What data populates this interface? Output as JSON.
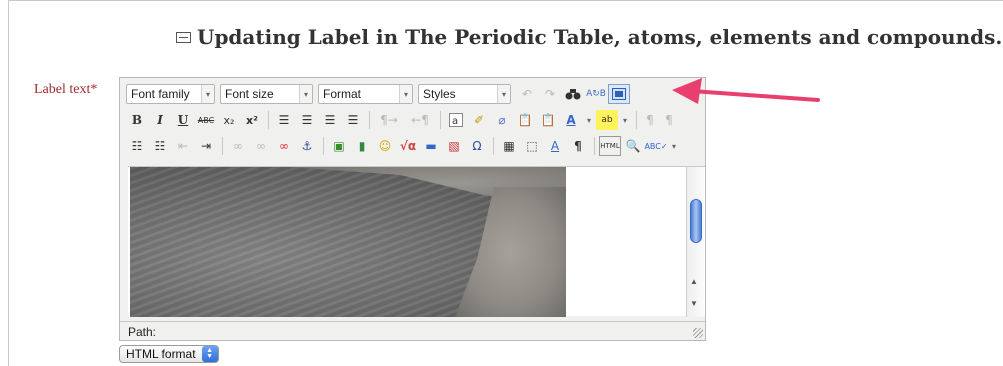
{
  "heading": {
    "text": "Updating Label in The Periodic Table, atoms, elements and compounds.",
    "help": "?"
  },
  "field": {
    "label": "Label text",
    "required_mark": "*"
  },
  "toolbar": {
    "row1": {
      "font_family": "Font family",
      "font_size": "Font size",
      "format": "Format",
      "styles": "Styles"
    },
    "row2": {
      "bold": "B",
      "italic": "I",
      "underline": "U",
      "strike": "ABC",
      "subscript": "x₂",
      "superscript": "x²"
    }
  },
  "path": {
    "label": "Path:"
  },
  "format_select": {
    "value": "HTML format"
  },
  "colors": {
    "accent_arrow": "#e83f6f",
    "label_red": "#a02a2a",
    "help_orange": "#e9a21b"
  }
}
